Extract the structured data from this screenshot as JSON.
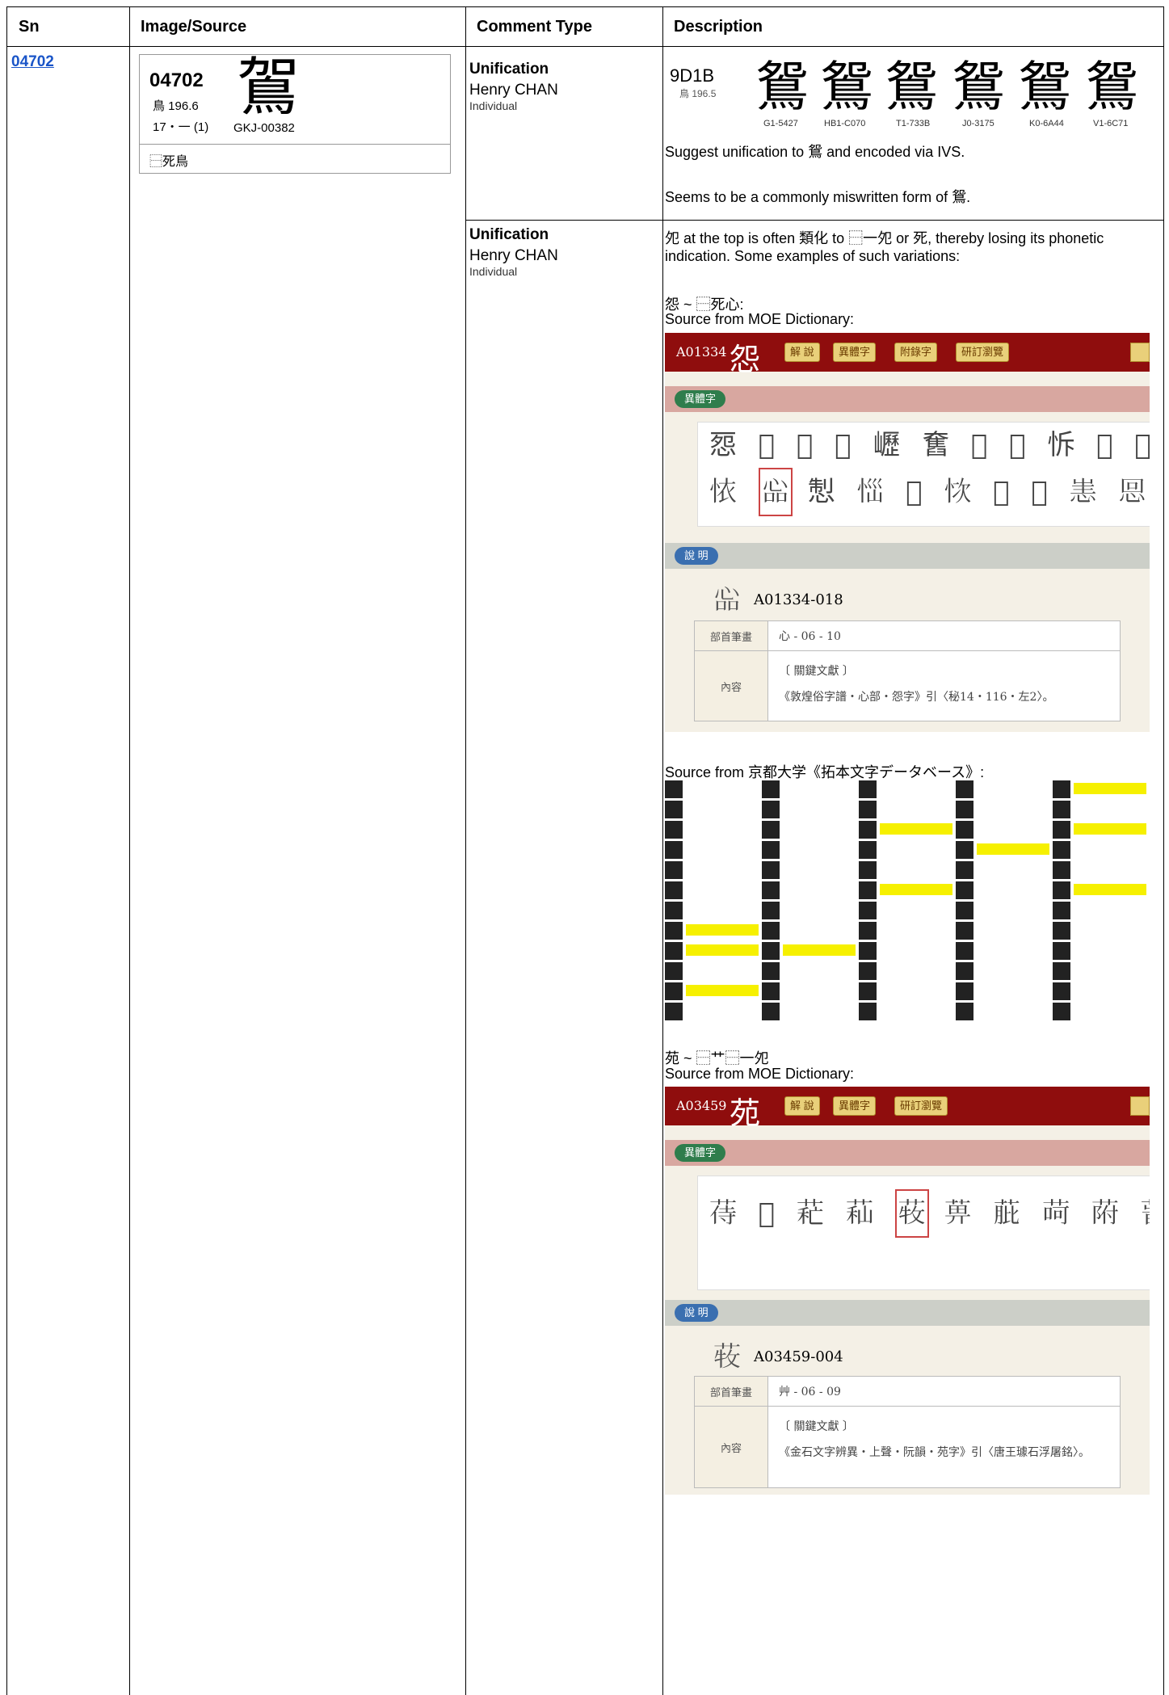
{
  "headers": [
    "Sn",
    "Image/Source",
    "Comment Type",
    "Description"
  ],
  "sn": "04702",
  "card": {
    "id": "04702",
    "radical": "鳥 196.6",
    "strokes": "17・一 (1)",
    "glyph": "鴐",
    "source": "GKJ-00382",
    "ids": "⿱死鳥"
  },
  "comments": [
    {
      "type": "Unification",
      "name": "Henry CHAN",
      "org": "Individual"
    },
    {
      "type": "Unification",
      "name": "Henry CHAN",
      "org": "Individual"
    }
  ],
  "desc1": {
    "code": "9D1B",
    "code_sub": "鳥 196.5",
    "glyph": "鴛",
    "sources": [
      "G1-5427",
      "HB1-C070",
      "T1-733B",
      "J0-3175",
      "K0-6A44",
      "V1-6C71"
    ],
    "line1": "Suggest unification to 鴛 and encoded via IVS.",
    "line2": "Seems to be a commonly miswritten form of 鴛."
  },
  "desc2": {
    "intro": "夗 at the top is often 類化 to ⿱一夗 or 死, thereby losing its phonetic indication. Some examples of such variations:",
    "ex1_title": "怨 ~ ⿱死心:",
    "ex1_source": "Source from MOE Dictionary:",
    "kyoto_source": "Source from 京都大学《拓本文字データベース》:",
    "ex2_title": "苑 ~ ⿱⺾⿱一夗",
    "ex2_source": "Source from MOE Dictionary:"
  },
  "moe1": {
    "code": "A01334",
    "big": "怨",
    "tabs": [
      "解 說",
      "異體字",
      "附錄字",
      "研訂瀏覽"
    ],
    "variants_label": "異體字",
    "row1": "㤪 𠨗 𢙄 𠰣 㠣 𡚒 𢍠 𢗰 𢘛 𡖅 𢙵",
    "row2_pre": "𢙇",
    "row2_sel": "𢙈",
    "row2_post": "𢛁 𢙉 𢚣 𢙊 𢚤 𢙋 𢙌 𢙍 𢙎",
    "explain_label": "說 明",
    "detail_glyph": "𢙈",
    "detail_id": "A01334-018",
    "rad_key": "部首筆畫",
    "rad_val": "心 - 06 - 10",
    "content_key": "內容",
    "content_line1": "〔 關鍵文獻 〕",
    "content_line2": "《敦煌俗字譜・心部・怨字》引〈秘14・116・左2〉。"
  },
  "moe2": {
    "code": "A03459",
    "big": "苑",
    "tabs": [
      "解 說",
      "異體字",
      "研訂瀏覽"
    ],
    "variants_label": "異體字",
    "row1_pre": "𦱎 𦱏 𦱐 𦱑",
    "row1_sel": "𦱒",
    "row1_post": "𦱓 𦱔 𦱕 𦱖 𦱗",
    "explain_label": "說 明",
    "detail_glyph": "𦱒",
    "detail_id": "A03459-004",
    "rad_key": "部首筆畫",
    "rad_val": "艸 - 06 - 09",
    "content_key": "內容",
    "content_line1": "〔 關鍵文獻 〕",
    "content_line2": "《金石文字辨異・上聲・阮韻・苑字》引〈唐王璩石浮屠銘〉。"
  }
}
